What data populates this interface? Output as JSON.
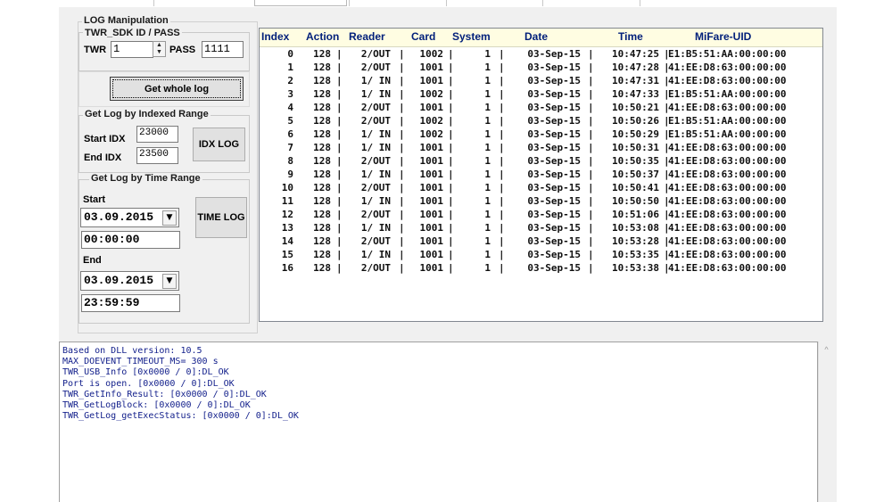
{
  "log_group": {
    "title": "LOG Manipulation",
    "sdk_title": "TWR_SDK ID / PASS",
    "twr_label": "TWR",
    "twr_value": "1",
    "pass_label": "PASS",
    "pass_value": "1111",
    "get_whole_log": "Get whole log"
  },
  "idx_group": {
    "title": "Get Log by Indexed Range",
    "start_label": "Start IDX",
    "start_value": "23000",
    "end_label": "End IDX",
    "end_value": "23500",
    "button": "IDX LOG"
  },
  "time_group": {
    "title": "Get Log by Time Range",
    "start_label": "Start",
    "start_date": "03.09.2015",
    "start_time": "00:00:00",
    "end_label": "End",
    "end_date": "03.09.2015",
    "end_time": "23:59:59",
    "button": "TIME LOG"
  },
  "table": {
    "headers": [
      "Index",
      "Action",
      "Reader",
      "Card",
      "System",
      "Date",
      "Time",
      "MiFare-UID"
    ],
    "rows": [
      [
        "0",
        "128",
        "2/OUT",
        "1002",
        "1",
        "03-Sep-15",
        "10:47:25",
        "E1:B5:51:AA:00:00:00"
      ],
      [
        "1",
        "128",
        "2/OUT",
        "1001",
        "1",
        "03-Sep-15",
        "10:47:28",
        "41:EE:D8:63:00:00:00"
      ],
      [
        "2",
        "128",
        "1/ IN",
        "1001",
        "1",
        "03-Sep-15",
        "10:47:31",
        "41:EE:D8:63:00:00:00"
      ],
      [
        "3",
        "128",
        "1/ IN",
        "1002",
        "1",
        "03-Sep-15",
        "10:47:33",
        "E1:B5:51:AA:00:00:00"
      ],
      [
        "4",
        "128",
        "2/OUT",
        "1001",
        "1",
        "03-Sep-15",
        "10:50:21",
        "41:EE:D8:63:00:00:00"
      ],
      [
        "5",
        "128",
        "2/OUT",
        "1002",
        "1",
        "03-Sep-15",
        "10:50:26",
        "E1:B5:51:AA:00:00:00"
      ],
      [
        "6",
        "128",
        "1/ IN",
        "1002",
        "1",
        "03-Sep-15",
        "10:50:29",
        "E1:B5:51:AA:00:00:00"
      ],
      [
        "7",
        "128",
        "1/ IN",
        "1001",
        "1",
        "03-Sep-15",
        "10:50:31",
        "41:EE:D8:63:00:00:00"
      ],
      [
        "8",
        "128",
        "2/OUT",
        "1001",
        "1",
        "03-Sep-15",
        "10:50:35",
        "41:EE:D8:63:00:00:00"
      ],
      [
        "9",
        "128",
        "1/ IN",
        "1001",
        "1",
        "03-Sep-15",
        "10:50:37",
        "41:EE:D8:63:00:00:00"
      ],
      [
        "10",
        "128",
        "2/OUT",
        "1001",
        "1",
        "03-Sep-15",
        "10:50:41",
        "41:EE:D8:63:00:00:00"
      ],
      [
        "11",
        "128",
        "1/ IN",
        "1001",
        "1",
        "03-Sep-15",
        "10:50:50",
        "41:EE:D8:63:00:00:00"
      ],
      [
        "12",
        "128",
        "2/OUT",
        "1001",
        "1",
        "03-Sep-15",
        "10:51:06",
        "41:EE:D8:63:00:00:00"
      ],
      [
        "13",
        "128",
        "1/ IN",
        "1001",
        "1",
        "03-Sep-15",
        "10:53:08",
        "41:EE:D8:63:00:00:00"
      ],
      [
        "14",
        "128",
        "2/OUT",
        "1001",
        "1",
        "03-Sep-15",
        "10:53:28",
        "41:EE:D8:63:00:00:00"
      ],
      [
        "15",
        "128",
        "1/ IN",
        "1001",
        "1",
        "03-Sep-15",
        "10:53:35",
        "41:EE:D8:63:00:00:00"
      ],
      [
        "16",
        "128",
        "2/OUT",
        "1001",
        "1",
        "03-Sep-15",
        "10:53:38",
        "41:EE:D8:63:00:00:00"
      ]
    ]
  },
  "console": {
    "lines": [
      "Based on DLL version: 10.5",
      "MAX_DOEVENT_TIMEOUT_MS= 300 s",
      "TWR_USB_Info [0x0000 / 0]:DL_OK",
      "Port is open. [0x0000 / 0]:DL_OK",
      "TWR_GetInfo_Result: [0x0000 / 0]:DL_OK",
      "TWR_GetLogBlock: [0x0000 / 0]:DL_OK",
      "TWR_GetLog_getExecStatus: [0x0000 / 0]:DL_OK"
    ]
  },
  "icons": {
    "spin_up": "▲",
    "spin_down": "▼",
    "dropdown": "▼",
    "scroll_up": "^"
  }
}
